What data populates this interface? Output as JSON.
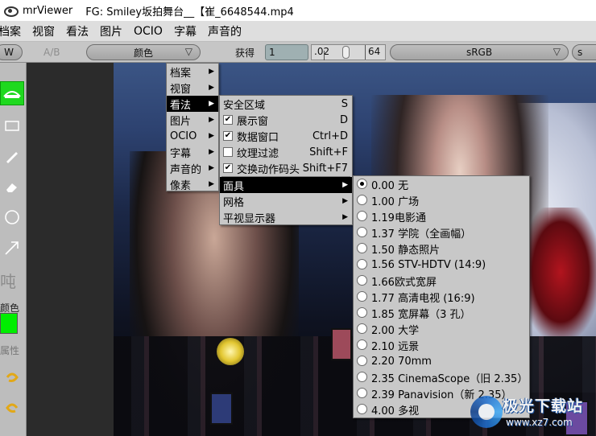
{
  "window": {
    "app_name": "mrViewer",
    "file_title": "FG: Smiley坂拍舞台__【崔_6648544.mp4"
  },
  "menubar": {
    "items": [
      "档案",
      "视窗",
      "看法",
      "图片",
      "OCIO",
      "字幕",
      "声音的"
    ]
  },
  "toolbar": {
    "w_label": "W",
    "ab_label": "A/B",
    "color_label": "颜色",
    "gain_label": "获得",
    "gain_value": "1",
    "gamma_value": ".02",
    "slider_max": "64",
    "colorspace": "sRGB",
    "colorspace2": "s"
  },
  "toolcol": {
    "text_tool": "吨",
    "color_label": "颜色",
    "color_value": "#00ee00",
    "props_label": "属性"
  },
  "menu_main": {
    "items": [
      "档案",
      "视窗",
      "看法",
      "图片",
      "OCIO",
      "字幕",
      "声音的",
      "像素"
    ],
    "selected": "看法"
  },
  "menu_view": {
    "items": [
      {
        "label": "安全区域",
        "shortcut": "S",
        "check": null
      },
      {
        "label": "展示窗",
        "shortcut": "D",
        "check": true
      },
      {
        "label": "数据窗口",
        "shortcut": "Ctrl+D",
        "check": true
      },
      {
        "label": "纹理过滤",
        "shortcut": "Shift+F",
        "check": false
      },
      {
        "label": "交换动作码头",
        "shortcut": "Shift+F7",
        "check": true
      },
      {
        "label": "面具",
        "shortcut": "",
        "check": null,
        "submenu": true,
        "selected": true
      },
      {
        "label": "网格",
        "shortcut": "",
        "check": null,
        "submenu": true
      },
      {
        "label": "平视显示器",
        "shortcut": "",
        "check": null,
        "submenu": true
      }
    ]
  },
  "menu_mask": {
    "selected_index": 0,
    "items": [
      "0.00 无",
      "1.00 广场",
      "1.19电影通",
      "1.37 学院（全画幅）",
      "1.50 静态照片",
      "1.56 STV-HDTV (14:9)",
      "1.66欧式宽屏",
      "1.77 高清电视 (16:9)",
      "1.85 宽屏幕（3 孔）",
      "2.00 大学",
      "2.10 远景",
      "2.20 70mm",
      "2.35 CinemaScope（旧 2.35）",
      "2.39 Panavision（新 2.35）",
      "4.00 多视"
    ]
  },
  "watermark": {
    "name": "极光下载站",
    "url": "www.xz7.com"
  }
}
